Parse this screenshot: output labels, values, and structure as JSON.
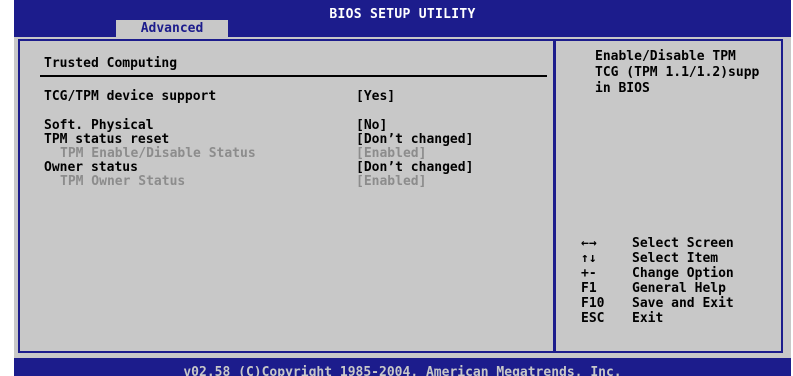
{
  "header": {
    "title": "BIOS SETUP UTILITY",
    "active_tab": "Advanced"
  },
  "main": {
    "section_title": "Trusted Computing",
    "items": [
      {
        "label": "TCG/TPM device support",
        "value": "[Yes]"
      },
      {
        "label": "Soft. Physical",
        "value": "[No]"
      },
      {
        "label": "TPM status reset",
        "value": "[Don’t changed]"
      },
      {
        "label": "TPM Enable/Disable Status",
        "value": "[Enabled]"
      },
      {
        "label": "Owner status",
        "value": "[Don’t changed]"
      },
      {
        "label": "TPM Owner Status",
        "value": "[Enabled]"
      }
    ]
  },
  "help": {
    "text": "Enable/Disable TPM\nTCG (TPM 1.1/1.2)supp\nin BIOS"
  },
  "keys": [
    {
      "key": "←→",
      "desc": "Select Screen"
    },
    {
      "key": "↑↓",
      "desc": "Select Item"
    },
    {
      "key": "+-",
      "desc": "Change Option"
    },
    {
      "key": "F1",
      "desc": "General Help"
    },
    {
      "key": "F10",
      "desc": "Save and Exit"
    },
    {
      "key": "ESC",
      "desc": "Exit"
    }
  ],
  "footer": {
    "copyright": "v02.58 (C)Copyright 1985-2004, American Megatrends, Inc."
  },
  "colors": {
    "title_bg": "#1c1c8c",
    "panel_bg": "#c8c8c8",
    "disabled_text": "#8c8c8c"
  }
}
